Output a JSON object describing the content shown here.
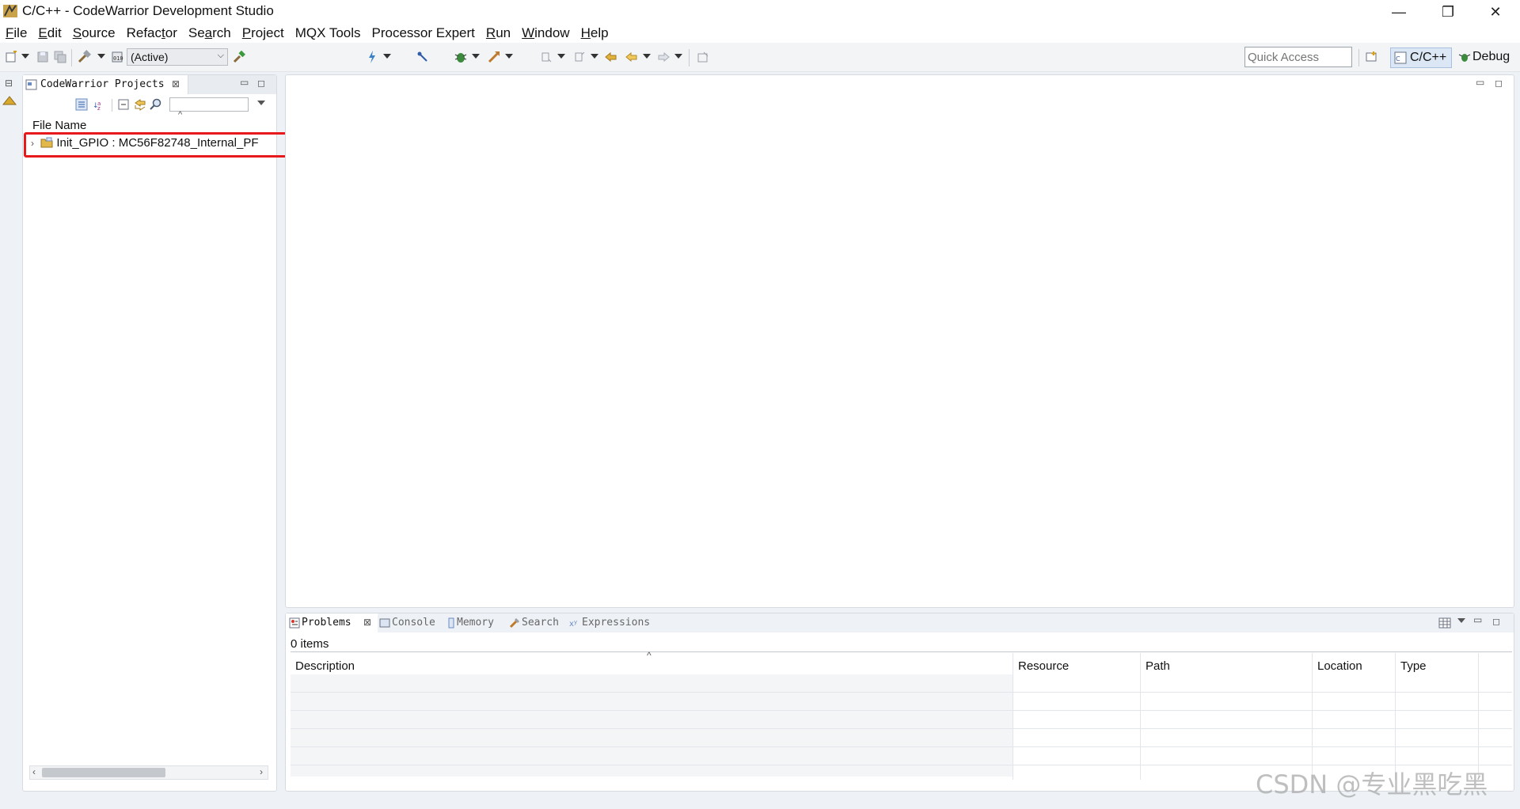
{
  "window": {
    "title": "C/C++ - CodeWarrior Development Studio",
    "minimize": "—",
    "restore": "❐",
    "close": "✕"
  },
  "menu": [
    {
      "pre": "",
      "key": "F",
      "post": "ile"
    },
    {
      "pre": "",
      "key": "E",
      "post": "dit"
    },
    {
      "pre": "",
      "key": "S",
      "post": "ource"
    },
    {
      "pre": "Refac",
      "key": "t",
      "post": "or"
    },
    {
      "pre": "Se",
      "key": "a",
      "post": "rch"
    },
    {
      "pre": "",
      "key": "P",
      "post": "roject"
    },
    {
      "pre": "MQX Tools",
      "key": "",
      "post": ""
    },
    {
      "pre": "Processor Expert",
      "key": "",
      "post": ""
    },
    {
      "pre": "",
      "key": "R",
      "post": "un"
    },
    {
      "pre": "",
      "key": "W",
      "post": "indow"
    },
    {
      "pre": "",
      "key": "H",
      "post": "elp"
    }
  ],
  "toolbar": {
    "build_config": "(Active)",
    "quick_access_placeholder": "Quick Access",
    "perspectives": {
      "cpp": "C/C++",
      "debug": "Debug"
    }
  },
  "explorer": {
    "tab_label": "CodeWarrior Projects",
    "column_header": "File Name",
    "project": {
      "name": "Init_GPIO",
      "separator": " : ",
      "target": "MC56F82748_Internal_PF"
    }
  },
  "bottom_panel": {
    "tabs": [
      "Problems",
      "Console",
      "Memory",
      "Search",
      "Expressions"
    ],
    "active_tab": "Problems",
    "item_count": "0 items",
    "columns": [
      "Description",
      "Resource",
      "Path",
      "Location",
      "Type"
    ]
  },
  "watermark": "CSDN @专业黑吃黑",
  "colors": {
    "highlight_box": "#e8191d",
    "perspective_active": "#dbe7f5"
  }
}
